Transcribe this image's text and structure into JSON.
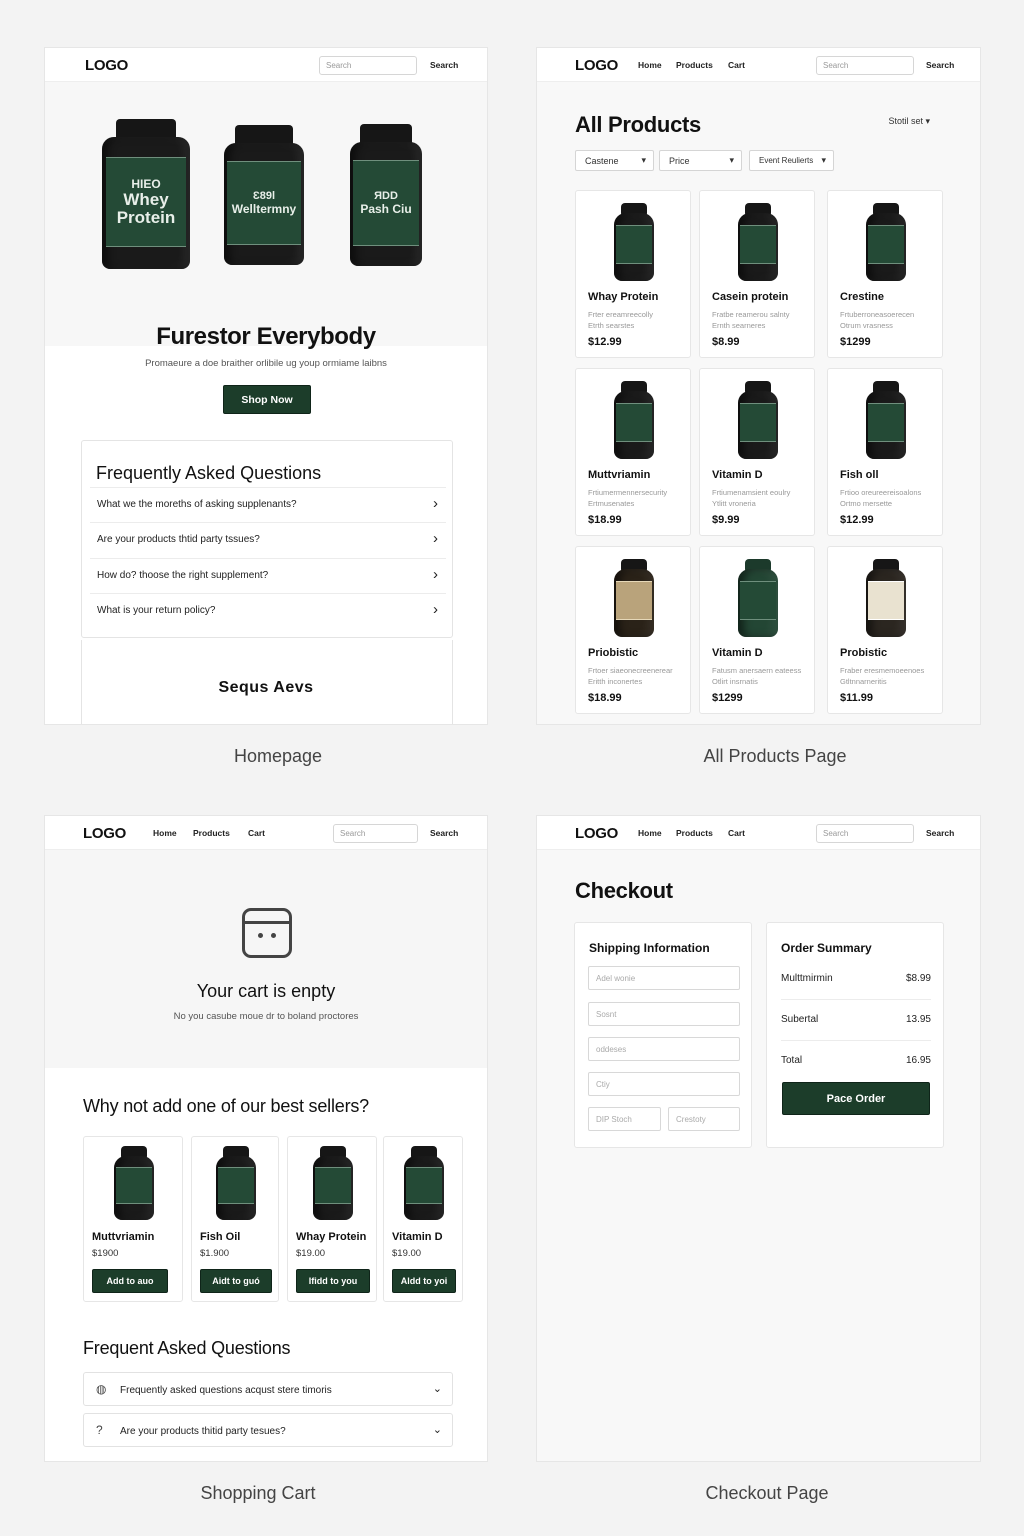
{
  "captions": {
    "homepage": "Homepage",
    "products": "All Products Page",
    "cart": "Shopping Cart",
    "checkout": "Checkout Page"
  },
  "nav": {
    "logo": "LOGO",
    "home": "Home",
    "products": "Products",
    "cart": "Cart",
    "search_placeholder": "Search",
    "search_button": "Search"
  },
  "homepage": {
    "hero_bottles": [
      {
        "line1": "HIEO",
        "line2": "Whey Protein"
      },
      {
        "line1": "Ɛ89l",
        "line2": "Welltermny"
      },
      {
        "line1": "ЯDD",
        "line2": "Pash Ciu"
      }
    ],
    "title": "Furestor Everybody",
    "subtitle": "Promaeure a doe braither orlibile ug youp ormiame laibns",
    "cta": "Shop Now",
    "faq": {
      "title": "Frequently Asked Questions",
      "items": [
        "What we the moreths of asking supplenants?",
        "Are your products thtid party tssues?",
        "How do? thoose the right supplement?",
        "What is your return policy?"
      ]
    },
    "bottom_text": "Sequs Aevs"
  },
  "products_page": {
    "title": "All Products",
    "sort": "Stotil set",
    "filters": [
      "Castene",
      "Price",
      "Event Reulierts"
    ],
    "items": [
      {
        "name": "Whay Protein",
        "desc1": "Frter ereamreecolly",
        "desc2": "Etrth searstes",
        "price": "$12.99",
        "style": "dark"
      },
      {
        "name": "Casein protein",
        "desc1": "Fratbe reamerou salnty",
        "desc2": "Ernth searneres",
        "price": "$8.99",
        "style": "dark"
      },
      {
        "name": "Crestine",
        "desc1": "Frtuberroneasoerecen",
        "desc2": "Otrum vrasness",
        "price": "$1299",
        "style": "dark"
      },
      {
        "name": "Muttvriamin",
        "desc1": "Frtiumermennersecurity",
        "desc2": "Ertmusenates",
        "price": "$18.99",
        "style": "dark"
      },
      {
        "name": "Vitamin D",
        "desc1": "Frtiumenamsient eoulry",
        "desc2": "Ytlitt vroneria",
        "price": "$9.99",
        "style": "dark"
      },
      {
        "name": "Fish oll",
        "desc1": "Frtioo oreureereisoalons",
        "desc2": "Ortmo mersette",
        "price": "$12.99",
        "style": "dark"
      },
      {
        "name": "Priobistic",
        "desc1": "Frtoer siaeonecreenerear",
        "desc2": "Eritth inconertes",
        "price": "$18.99",
        "style": "amber"
      },
      {
        "name": "Vitamin D",
        "desc1": "Fatusm anersaern eateess",
        "desc2": "Otlirt insrnatis",
        "price": "$1299",
        "style": "green"
      },
      {
        "name": "Probistic",
        "desc1": "Fraber eresmemoeenoes",
        "desc2": "Gtltnnarneritis",
        "price": "$11.99",
        "style": "cream"
      }
    ]
  },
  "cart_page": {
    "empty_title": "Your cart is enpty",
    "empty_sub": "No you casube moue dr to boland proctores",
    "best_sellers_title": "Why not add one of our best sellers?",
    "best_sellers": [
      {
        "name": "Muttvriamin",
        "price": "$1900",
        "button": "Add to auo"
      },
      {
        "name": "Fish Oil",
        "price": "$1.900",
        "button": "Aidt to guó"
      },
      {
        "name": "Whay Protein",
        "price": "$19.00",
        "button": "Ifidd to you"
      },
      {
        "name": "Vitamin D",
        "price": "$19.00",
        "button": "Aldd to yoi"
      }
    ],
    "faq_title": "Frequent Asked Questions",
    "faq": [
      "Frequently asked questions acqust stere timoris",
      "Are your products thitid party tesues?"
    ]
  },
  "checkout_page": {
    "title": "Checkout",
    "shipping": {
      "title": "Shipping Information",
      "fields": [
        "Adel wonie",
        "Sosnt",
        "oddeses",
        "Ctiy",
        "DIP Stoch",
        "Crestoty"
      ]
    },
    "summary": {
      "title": "Order Summary",
      "item_name": "Multtmirmin",
      "item_price": "$8.99",
      "subtotal_label": "Subertal",
      "subtotal_value": "13.95",
      "total_label": "Total",
      "total_value": "16.95",
      "button": "Pace Order"
    }
  },
  "colors": {
    "accent": "#1c3d2a",
    "bottle_label": "#244a36"
  }
}
